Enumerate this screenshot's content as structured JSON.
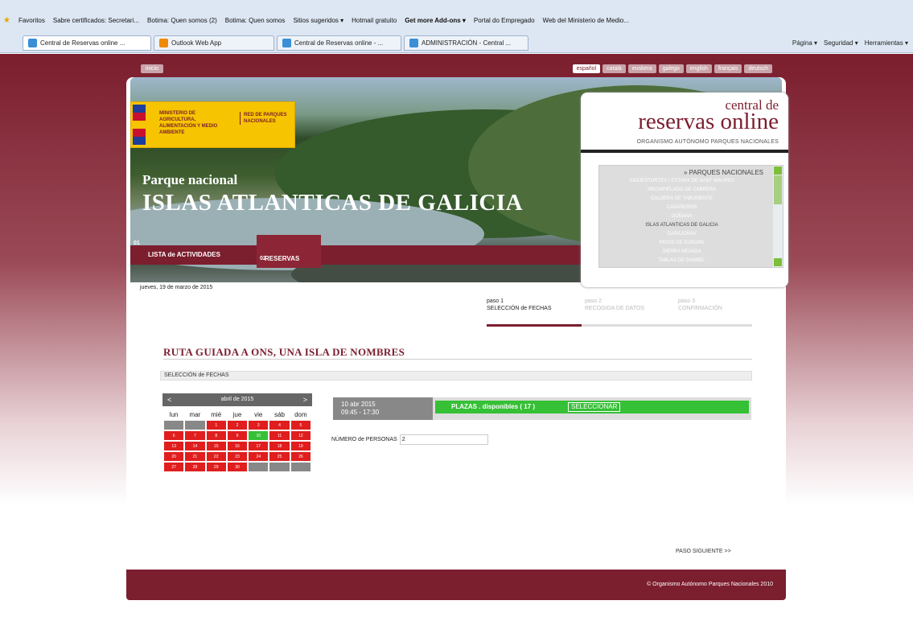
{
  "browser": {
    "favorites_label": "Favoritos",
    "favorites": [
      "Sabre certificados: Secretari...",
      "Botima: Quen somos (2)",
      "Botima: Quen somos",
      "Sitios sugeridos ▾",
      "Hotmail gratuito",
      "Get more Add-ons ▾",
      "Portal do Empregado",
      "Web del Ministerio de Medio..."
    ],
    "tabs": [
      {
        "label": "Central de Reservas online ..."
      },
      {
        "label": "Outlook Web App"
      },
      {
        "label": "Central de Reservas online - ..."
      },
      {
        "label": "ADMINISTRACIÓN - Central ..."
      }
    ],
    "commands": [
      "Página ▾",
      "Seguridad ▾",
      "Herramientas ▾"
    ]
  },
  "site": {
    "nav_home": "inicio",
    "languages": [
      "español",
      "català",
      "euskera",
      "galego",
      "english",
      "français",
      "deutsch"
    ],
    "active_language": "español",
    "logo": {
      "ministry": "MINISTERIO DE AGRICULTURA, ALIMENTACIÓN Y MEDIO AMBIENTE",
      "network": "RED DE PARQUES NACIONALES"
    },
    "park_subtitle": "Parque nacional",
    "park_title": "ISLAS ATLANTICAS DE GALICIA",
    "menu": [
      {
        "num": "01",
        "label": "LISTA de ACTIVIDADES"
      },
      {
        "num": "02",
        "label": "RESERVAS"
      }
    ],
    "brand": {
      "line1": "central de",
      "line2": "reservas online",
      "line3": "ORGANISMO AUTÓNOMO PARQUES NACIONALES"
    },
    "parks_header": "» PARQUES NACIONALES",
    "parks": [
      "AIGÜESTORTES I ESTANY DE SANT MAURICI",
      "ARCHIPIÉLAGO DE CABRERA",
      "CALDERA DE TABURIENTE",
      "CABAÑEROS",
      "DOÑANA",
      "ISLAS ATLANTICAS DE GALICIA",
      "GARAJONAY",
      "PICOS DE EUROPA",
      "SIERRA NEVADA",
      "TABLAS DE DAIMIEL"
    ],
    "date_text": "jueves, 19 de marzo de 2015",
    "steps": [
      {
        "num": "paso 1",
        "label": "SELECCIÓN de FECHAS"
      },
      {
        "num": "paso 2",
        "label": "RECOGIDA DE DATOS"
      },
      {
        "num": "paso 3",
        "label": "CONFIRMACIÓN"
      }
    ],
    "route_title": "RUTA GUIADA A ONS, UNA ISLA DE NOMBRES",
    "section_label": "SELECCIÓN de FECHAS",
    "calendar": {
      "month": "abril de 2015",
      "prev": "<",
      "next": ">",
      "weekdays": [
        "lun",
        "mar",
        "mié",
        "jue",
        "vie",
        "sáb",
        "dom"
      ],
      "weeks": [
        [
          "",
          "",
          "1",
          "2",
          "3",
          "4",
          "5"
        ],
        [
          "6",
          "7",
          "8",
          "9",
          "10",
          "11",
          "12"
        ],
        [
          "13",
          "14",
          "15",
          "16",
          "17",
          "18",
          "19"
        ],
        [
          "20",
          "21",
          "22",
          "23",
          "24",
          "25",
          "26"
        ],
        [
          "27",
          "28",
          "29",
          "30",
          "",
          "",
          ""
        ]
      ],
      "selected_day": "10"
    },
    "slot": {
      "date": "10 abr 2015",
      "time": "09:45 - 17:30",
      "availability": "PLAZAS . disponibles ( 17 )",
      "select_label": "SELECCIONAR"
    },
    "persons_label": "NÚMERO de PERSONAS",
    "persons_value": "2",
    "next_step": "PASO SIGUIENTE >>",
    "footer": "© Organismo Autónomo Parques Nacionales 2010"
  }
}
